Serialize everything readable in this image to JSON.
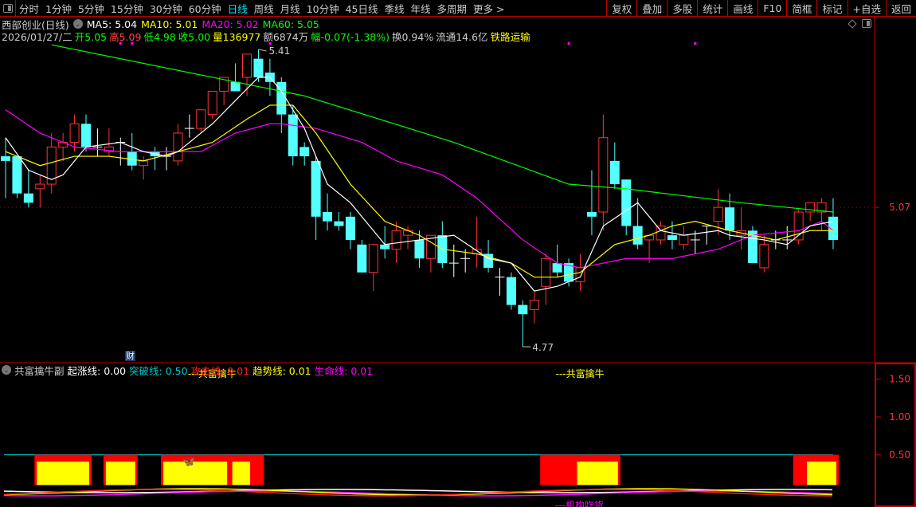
{
  "toolbar": {
    "periods": [
      "分时",
      "1分钟",
      "5分钟",
      "15分钟",
      "30分钟",
      "60分钟",
      "日线",
      "周线",
      "月线",
      "10分钟",
      "45日线",
      "季线",
      "年线",
      "多周期",
      "更多 >"
    ],
    "active_period": "日线",
    "buttons": [
      "复权",
      "叠加",
      "多股",
      "统计",
      "画线",
      "F10",
      "简框",
      "标记",
      "+自选",
      "返回"
    ]
  },
  "stock": {
    "name": "西部创业(日线)",
    "ma5": "MA5: 5.04",
    "ma10": "MA10: 5.01",
    "ma20": "MA20: 5.02",
    "ma60": "MA60: 5.05",
    "date": "2026/01/27/二",
    "open": "开5.05",
    "high": "高5.09",
    "low": "低4.98",
    "close": "收5.00",
    "volume": "量136977",
    "amount": "额6874万",
    "change": "幅-0.07(-1.38%)",
    "turnover": "换0.94%",
    "float_cap": "流通14.6亿",
    "industry": "铁路运输"
  },
  "colors": {
    "up": "#ff3333",
    "down": "#54ffff",
    "doji": "#ffffff",
    "ma5": "#ffffff",
    "ma10": "#ffff00",
    "ma20": "#ff00ff",
    "ma60": "#00ff00",
    "border": "#c00000"
  },
  "main_chart": {
    "price_range": [
      4.77,
      5.41
    ],
    "high_label": "5.41",
    "low_label": "4.77",
    "axis_label": "5.07",
    "candles": [
      [
        5.18,
        5.22,
        5.09,
        5.17
      ],
      [
        5.18,
        5.18,
        5.09,
        5.1
      ],
      [
        5.1,
        5.15,
        5.07,
        5.08
      ],
      [
        5.11,
        5.14,
        5.07,
        5.12
      ],
      [
        5.12,
        5.23,
        5.1,
        5.2
      ],
      [
        5.2,
        5.23,
        5.17,
        5.21
      ],
      [
        5.21,
        5.27,
        5.19,
        5.25
      ],
      [
        5.25,
        5.27,
        5.19,
        5.2
      ],
      [
        5.2,
        5.24,
        5.18,
        5.2
      ],
      [
        5.19,
        5.24,
        5.18,
        5.2
      ],
      [
        5.21,
        5.22,
        5.16,
        5.21
      ],
      [
        5.19,
        5.23,
        5.15,
        5.16
      ],
      [
        5.16,
        5.18,
        5.13,
        5.17
      ],
      [
        5.19,
        5.2,
        5.15,
        5.18
      ],
      [
        5.18,
        5.2,
        5.15,
        5.18
      ],
      [
        5.17,
        5.25,
        5.16,
        5.23
      ],
      [
        5.24,
        5.27,
        5.22,
        5.24
      ],
      [
        5.24,
        5.28,
        5.23,
        5.28
      ],
      [
        5.27,
        5.32,
        5.26,
        5.32
      ],
      [
        5.32,
        5.35,
        5.29,
        5.35
      ],
      [
        5.34,
        5.38,
        5.32,
        5.32
      ],
      [
        5.35,
        5.4,
        5.31,
        5.4
      ],
      [
        5.39,
        5.41,
        5.34,
        5.35
      ],
      [
        5.36,
        5.39,
        5.31,
        5.34
      ],
      [
        5.34,
        5.35,
        5.23,
        5.27
      ],
      [
        5.27,
        5.29,
        5.16,
        5.18
      ],
      [
        5.2,
        5.21,
        5.16,
        5.18
      ],
      [
        5.17,
        5.18,
        5.0,
        5.05
      ],
      [
        5.06,
        5.1,
        5.02,
        5.04
      ],
      [
        5.04,
        5.06,
        5.02,
        5.03
      ],
      [
        5.05,
        5.06,
        4.98,
        5.0
      ],
      [
        4.99,
        5.0,
        4.93,
        4.93
      ],
      [
        4.93,
        4.99,
        4.89,
        4.99
      ],
      [
        4.99,
        5.03,
        4.96,
        4.98
      ],
      [
        4.98,
        5.04,
        4.95,
        5.02
      ],
      [
        5.01,
        5.03,
        4.98,
        5.02
      ],
      [
        5.0,
        5.02,
        4.94,
        4.96
      ],
      [
        4.96,
        5.01,
        4.93,
        5.01
      ],
      [
        5.01,
        5.04,
        4.94,
        4.95
      ],
      [
        4.95,
        4.99,
        4.92,
        4.95
      ],
      [
        4.96,
        4.98,
        4.93,
        4.96
      ],
      [
        4.97,
        5.05,
        4.94,
        4.98
      ],
      [
        4.97,
        5.0,
        4.93,
        4.94
      ],
      [
        4.92,
        4.94,
        4.88,
        4.92
      ],
      [
        4.92,
        4.93,
        4.85,
        4.86
      ],
      [
        4.86,
        4.87,
        4.77,
        4.84
      ],
      [
        4.85,
        4.89,
        4.82,
        4.87
      ],
      [
        4.9,
        4.97,
        4.86,
        4.96
      ],
      [
        4.95,
        4.99,
        4.92,
        4.93
      ],
      [
        4.95,
        4.96,
        4.9,
        4.91
      ],
      [
        4.91,
        4.97,
        4.89,
        4.94
      ],
      [
        5.06,
        5.15,
        5.01,
        5.05
      ],
      [
        5.06,
        5.27,
        5.02,
        5.22
      ],
      [
        5.17,
        5.21,
        5.11,
        5.12
      ],
      [
        5.13,
        5.13,
        5.01,
        5.03
      ],
      [
        5.03,
        5.09,
        4.98,
        4.99
      ],
      [
        5.0,
        5.01,
        4.95,
        5.01
      ],
      [
        5.0,
        5.04,
        4.99,
        5.03
      ],
      [
        5.01,
        5.04,
        4.98,
        5.0
      ],
      [
        4.99,
        5.03,
        4.98,
        5.01
      ],
      [
        5.0,
        5.02,
        4.97,
        5.0
      ],
      [
        5.03,
        5.03,
        4.99,
        5.03
      ],
      [
        5.04,
        5.11,
        5.01,
        5.07
      ],
      [
        5.07,
        5.1,
        5.0,
        5.02
      ],
      [
        5.01,
        5.07,
        4.98,
        5.02
      ],
      [
        5.02,
        5.03,
        4.95,
        4.95
      ],
      [
        4.94,
        5.01,
        4.93,
        4.99
      ],
      [
        5.0,
        5.02,
        4.98,
        5.0
      ],
      [
        5.0,
        5.03,
        4.98,
        5.0
      ],
      [
        5.0,
        5.07,
        4.99,
        5.06
      ],
      [
        5.06,
        5.08,
        5.04,
        5.08
      ],
      [
        5.06,
        5.09,
        5.02,
        5.08
      ],
      [
        5.05,
        5.09,
        4.98,
        5.0
      ]
    ],
    "ma5": [
      [
        0,
        5.22
      ],
      [
        2,
        5.15
      ],
      [
        4,
        5.13
      ],
      [
        5,
        5.14
      ],
      [
        7,
        5.2
      ],
      [
        10,
        5.21
      ],
      [
        12,
        5.19
      ],
      [
        14,
        5.18
      ],
      [
        15,
        5.19
      ],
      [
        18,
        5.25
      ],
      [
        20,
        5.3
      ],
      [
        22,
        5.35
      ],
      [
        23,
        5.35
      ],
      [
        24,
        5.32
      ],
      [
        26,
        5.24
      ],
      [
        28,
        5.12
      ],
      [
        30,
        5.08
      ],
      [
        33,
        4.99
      ],
      [
        36,
        5.0
      ],
      [
        39,
        5.01
      ],
      [
        42,
        4.96
      ],
      [
        44,
        4.95
      ],
      [
        46,
        4.89
      ],
      [
        48,
        4.9
      ],
      [
        50,
        4.92
      ],
      [
        52,
        5.03
      ],
      [
        55,
        5.08
      ],
      [
        57,
        5.02
      ],
      [
        59,
        5.01
      ],
      [
        62,
        5.02
      ],
      [
        63,
        5.01
      ],
      [
        66,
        5.0
      ],
      [
        68,
        4.99
      ],
      [
        70,
        5.03
      ],
      [
        72,
        5.04
      ]
    ],
    "ma10": [
      [
        0,
        5.19
      ],
      [
        3,
        5.16
      ],
      [
        6,
        5.18
      ],
      [
        9,
        5.18
      ],
      [
        12,
        5.17
      ],
      [
        15,
        5.19
      ],
      [
        18,
        5.21
      ],
      [
        21,
        5.26
      ],
      [
        23,
        5.29
      ],
      [
        25,
        5.29
      ],
      [
        27,
        5.23
      ],
      [
        30,
        5.12
      ],
      [
        33,
        5.04
      ],
      [
        36,
        5.01
      ],
      [
        38,
        4.98
      ],
      [
        41,
        4.97
      ],
      [
        44,
        4.95
      ],
      [
        46,
        4.92
      ],
      [
        48,
        4.92
      ],
      [
        50,
        4.93
      ],
      [
        53,
        4.99
      ],
      [
        56,
        5.01
      ],
      [
        58,
        5.03
      ],
      [
        60,
        5.04
      ],
      [
        63,
        5.02
      ],
      [
        65,
        5.01
      ],
      [
        67,
        5.0
      ],
      [
        70,
        5.02
      ],
      [
        72,
        5.02
      ]
    ],
    "ma20": [
      [
        0,
        5.28
      ],
      [
        3,
        5.23
      ],
      [
        6,
        5.2
      ],
      [
        10,
        5.19
      ],
      [
        13,
        5.19
      ],
      [
        17,
        5.19
      ],
      [
        20,
        5.23
      ],
      [
        23,
        5.25
      ],
      [
        24,
        5.25
      ],
      [
        27,
        5.24
      ],
      [
        31,
        5.21
      ],
      [
        34,
        5.17
      ],
      [
        38,
        5.14
      ],
      [
        41,
        5.09
      ],
      [
        45,
        5.0
      ],
      [
        48,
        4.95
      ],
      [
        50,
        4.94
      ],
      [
        54,
        4.96
      ],
      [
        58,
        4.96
      ],
      [
        62,
        4.98
      ],
      [
        65,
        5.01
      ],
      [
        69,
        5.02
      ],
      [
        71,
        5.04
      ],
      [
        72,
        5.02
      ]
    ],
    "ma60": [
      [
        4,
        5.42
      ],
      [
        18,
        5.35
      ],
      [
        26,
        5.31
      ],
      [
        39,
        5.21
      ],
      [
        49,
        5.12
      ],
      [
        54,
        5.11
      ],
      [
        64,
        5.08
      ],
      [
        72,
        5.06
      ]
    ],
    "marker_indices": [
      10,
      11,
      23,
      49,
      60
    ],
    "finance_badge": "财"
  },
  "indicator": {
    "name": "共富擒牛副",
    "qizhang": "起涨线: 0.00",
    "tupo": "突破线: 0.50",
    "gongji": "攻击线: 0.01",
    "qushi": "趋势线: 0.01",
    "shengming": "生命线: 0.01",
    "axis_labels": [
      "1.50",
      "1.00",
      "0.50"
    ],
    "signal_label": "---共富擒牛",
    "signal_label_indices": [
      16,
      48
    ],
    "bottom_label": "---机构吃货",
    "red_blocks": [
      [
        3,
        7
      ],
      [
        9,
        11
      ],
      [
        14,
        22
      ],
      [
        47,
        53
      ],
      [
        69,
        72
      ]
    ],
    "yellow_blocks": [
      [
        3,
        7
      ],
      [
        9,
        11
      ],
      [
        14,
        19
      ],
      [
        20,
        21
      ],
      [
        50,
        53
      ],
      [
        70,
        72
      ]
    ],
    "butterfly_index": 16
  }
}
